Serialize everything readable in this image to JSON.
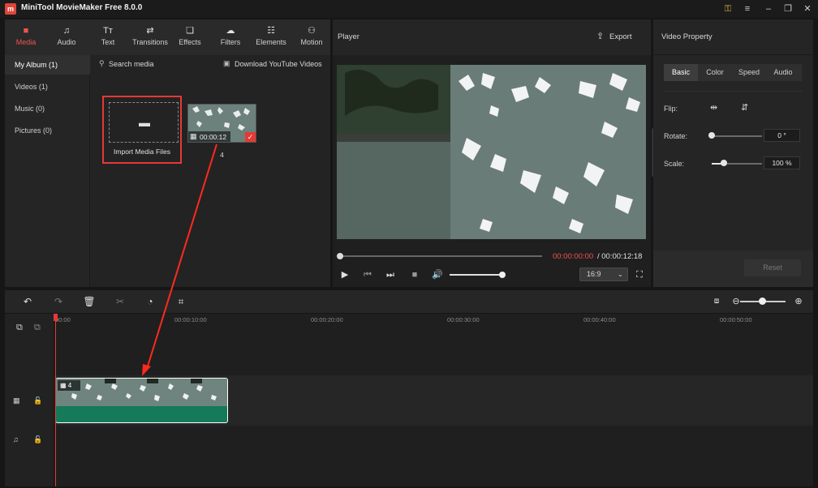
{
  "app": {
    "title": "MiniTool MovieMaker Free 8.0.0",
    "logo_letter": "m"
  },
  "window_controls": [
    "key-icon",
    "minimize-icon",
    "maximize-icon",
    "close-icon"
  ],
  "media_tabs": [
    {
      "label": "Media",
      "icon": "folder-icon",
      "active": true
    },
    {
      "label": "Audio",
      "icon": "music-icon"
    },
    {
      "label": "Text",
      "icon": "text-icon"
    },
    {
      "label": "Transitions",
      "icon": "transitions-icon"
    },
    {
      "label": "Effects",
      "icon": "effects-icon"
    },
    {
      "label": "Filters",
      "icon": "filters-icon"
    },
    {
      "label": "Elements",
      "icon": "elements-icon"
    },
    {
      "label": "Motion",
      "icon": "motion-icon"
    }
  ],
  "sidebar": [
    {
      "label": "My Album  (1)",
      "active": true
    },
    {
      "label": "Videos  (1)"
    },
    {
      "label": "Music  (0)"
    },
    {
      "label": "Pictures  (0)"
    }
  ],
  "media": {
    "search_placeholder": "Search media",
    "download_link": "Download YouTube Videos",
    "import_label": "Import Media Files",
    "clip": {
      "duration": "00:00:12",
      "name": "4"
    }
  },
  "player": {
    "title": "Player",
    "export_label": "Export",
    "time_current": "00:00:00:00",
    "time_total": " / 00:00:12:18",
    "aspect_ratio": "16:9",
    "progress": 0,
    "volume": 1.0
  },
  "properties": {
    "title": "Video Property",
    "tabs": [
      "Basic",
      "Color",
      "Speed",
      "Audio"
    ],
    "active_tab": "Basic",
    "flip_label": "Flip:",
    "rotate_label": "Rotate:",
    "rotate_value": "0 °",
    "scale_label": "Scale:",
    "scale_value": "100 %",
    "reset_label": "Reset"
  },
  "timeline": {
    "ticks": [
      "00:00",
      "00:00:10:00",
      "00:00:20:00",
      "00:00:30:00",
      "00:00:40:00",
      "00:00:50:00"
    ],
    "clip_label": "4"
  },
  "colors": {
    "accent": "#e53935",
    "clip_green": "#147a59",
    "panel": "#252525"
  }
}
